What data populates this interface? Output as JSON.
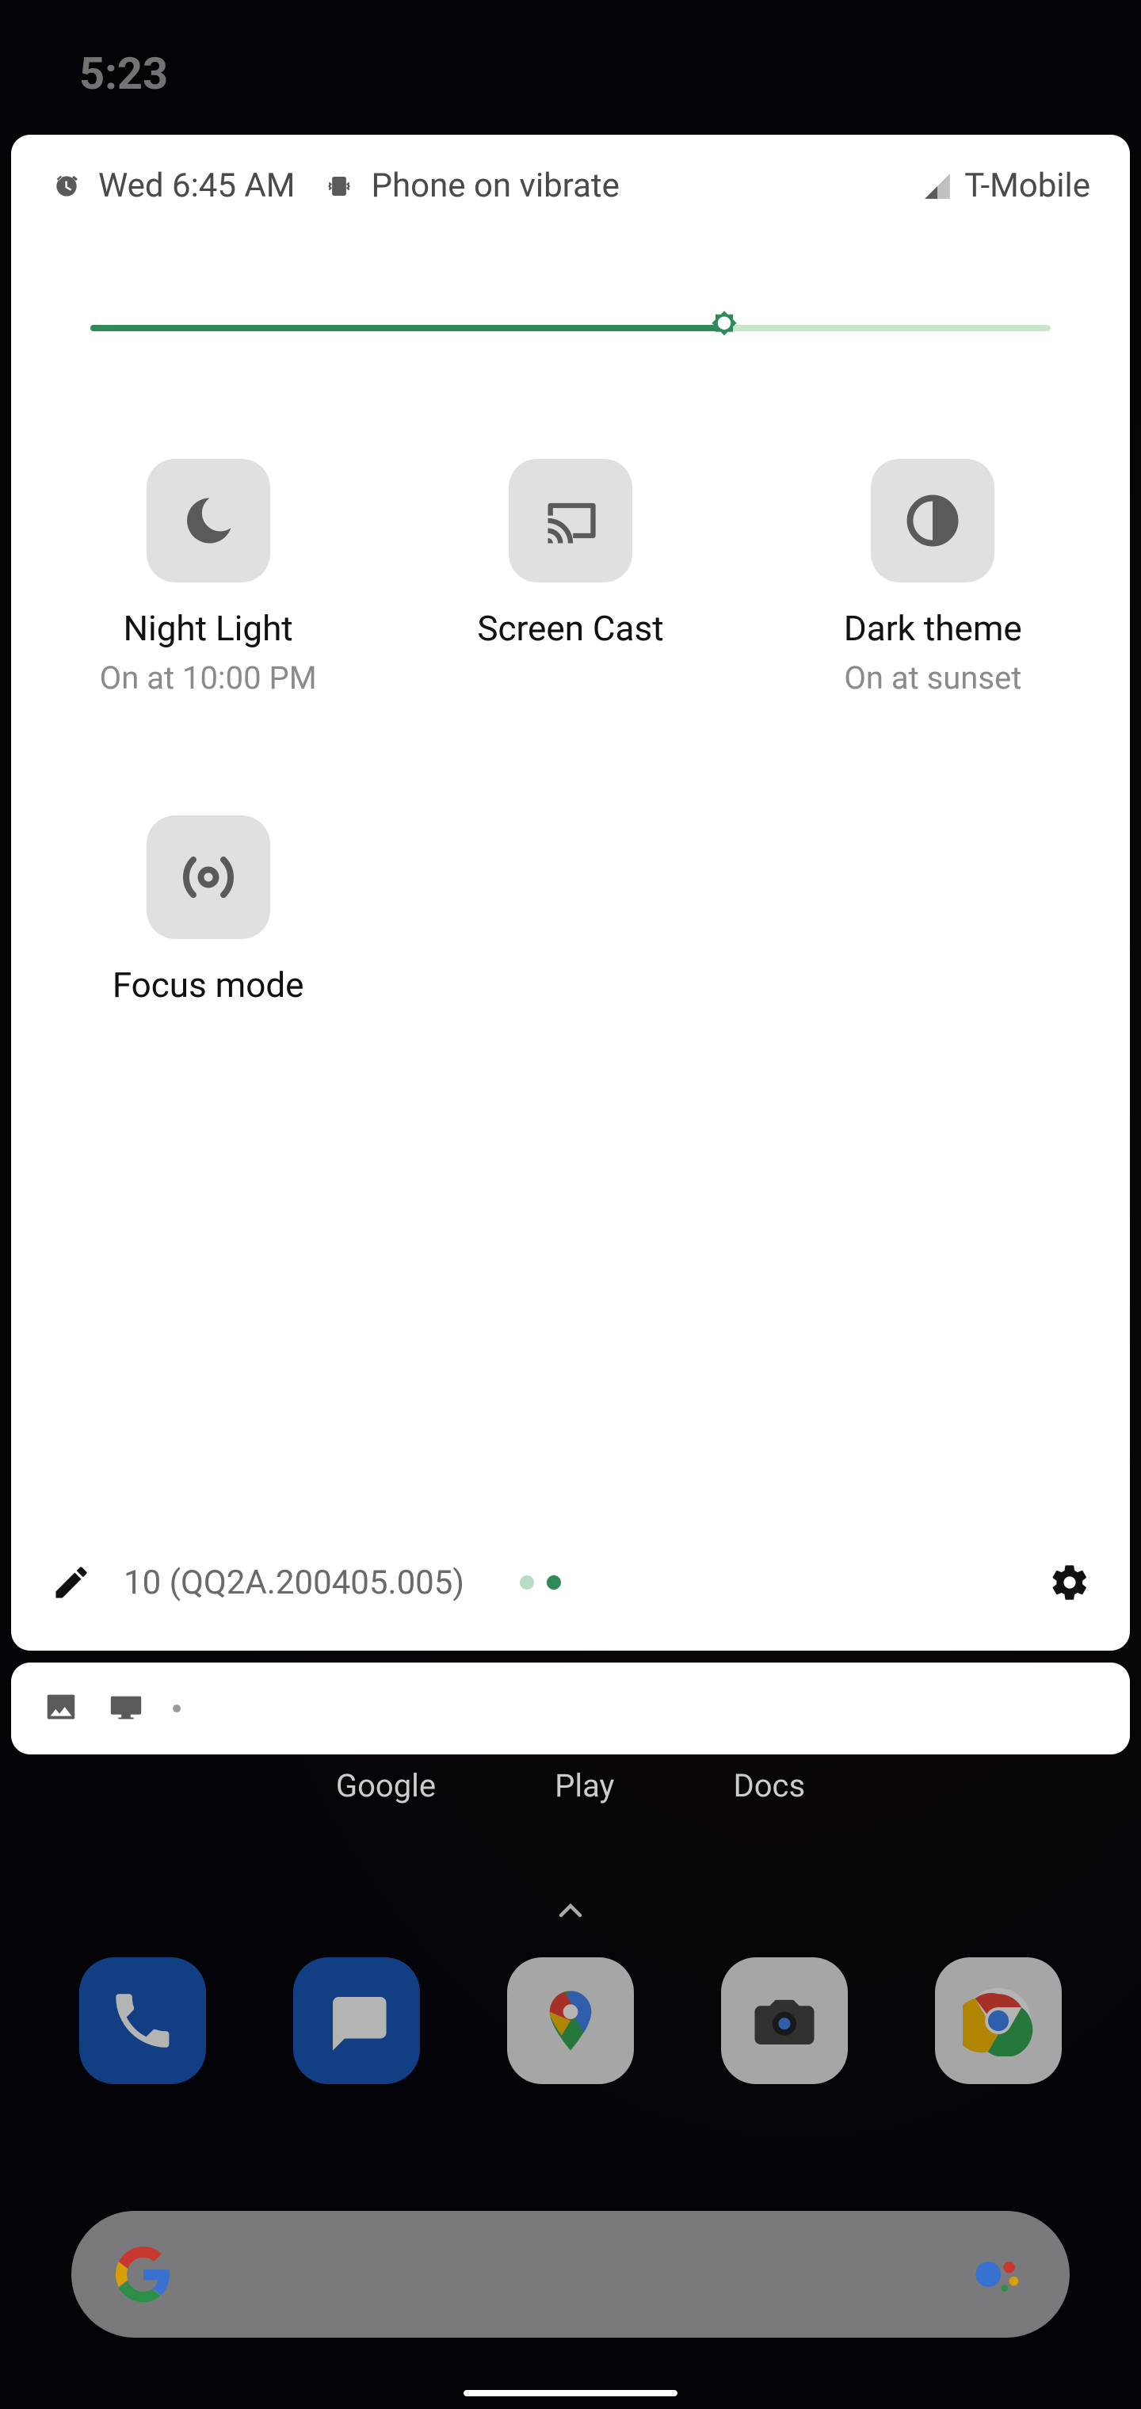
{
  "status": {
    "time": "5:23"
  },
  "header": {
    "alarm": "Wed 6:45 AM",
    "ringer": "Phone on vibrate",
    "carrier": "T-Mobile"
  },
  "brightness": {
    "percent": 66
  },
  "tiles": [
    {
      "label": "Night Light",
      "sub": "On at 10:00 PM",
      "icon": "moon"
    },
    {
      "label": "Screen Cast",
      "sub": "",
      "icon": "cast"
    },
    {
      "label": "Dark theme",
      "sub": "On at sunset",
      "icon": "halfcircle"
    },
    {
      "label": "Focus mode",
      "sub": "",
      "icon": "focus"
    }
  ],
  "build": "10 (QQ2A.200405.005)",
  "page": {
    "total": 2,
    "active": 1
  },
  "folders": [
    "Google",
    "Play",
    "Docs"
  ],
  "dock": [
    "phone",
    "messages",
    "maps",
    "camera",
    "chrome"
  ]
}
